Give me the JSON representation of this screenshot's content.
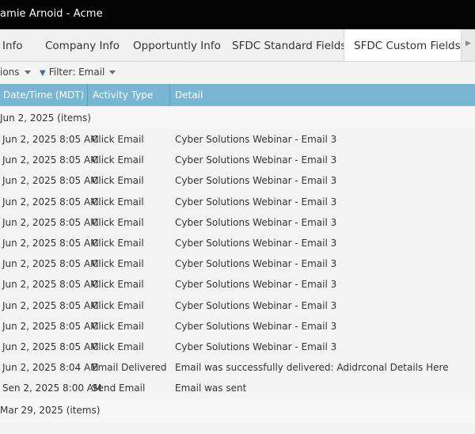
{
  "window": {
    "title": "amie Arnoid - Acme"
  },
  "tabs": [
    {
      "label": "Info"
    },
    {
      "label": "Company Info"
    },
    {
      "label": "Opportuntly Info"
    },
    {
      "label": "SFDC Standard Fields"
    },
    {
      "label": "SFDC Custom Fields"
    }
  ],
  "toolbar": {
    "actions_label": "ions",
    "filter_label": "Filter: Email"
  },
  "table": {
    "columns": [
      "Date/Time (MDT)",
      "Activity Type",
      "Detail"
    ],
    "groups": [
      {
        "label": "Jun 2, 2025 (items)"
      },
      {
        "label": "Mar 29, 2025 (items)"
      }
    ],
    "rows": [
      {
        "date": "Jun 2, 2025 8:05 AM",
        "activity": "Click Email",
        "detail": "Cyber Solutions Webinar - Email 3"
      },
      {
        "date": "Jun 2, 2025 8:05 AM",
        "activity": "Click Email",
        "detail": "Cyber Solutions Webinar - Email 3"
      },
      {
        "date": "Jun 2, 2025 8:05 AM",
        "activity": "Click Email",
        "detail": "Cyber Solutions Webinar - Email 3"
      },
      {
        "date": "Jun 2, 2025 8:05 AM",
        "activity": "Click Email",
        "detail": "Cyber Solutions Webinar - Email 3"
      },
      {
        "date": "Jun 2, 2025 8:05 AM",
        "activity": "Click Email",
        "detail": "Cyber Solutions Webinar - Email 3"
      },
      {
        "date": "Jun 2, 2025 8:05 AM",
        "activity": "Click Email",
        "detail": "Cyber Solutions Webinar - Email 3"
      },
      {
        "date": "Jun 2, 2025 8:05 AM",
        "activity": "Click Email",
        "detail": "Cyber Solutions Webinar - Email 3"
      },
      {
        "date": "Jun 2, 2025 8:05 AM",
        "activity": "Click Email",
        "detail": "Cyber Solutions Webinar - Email 3"
      },
      {
        "date": "Jun 2, 2025 8:05 AM",
        "activity": "Click Email",
        "detail": "Cyber Solutions Webinar - Email 3"
      },
      {
        "date": "Jun 2, 2025 8:05 AM",
        "activity": "Click Email",
        "detail": "Cyber Solutions Webinar - Email 3"
      },
      {
        "date": "Jun 2, 2025 8:05 AM",
        "activity": "Click Email",
        "detail": "Cyber Solutions Webinar - Email 3"
      },
      {
        "date": "Jun 2, 2025 8:04 AM",
        "activity": "Email Delivered",
        "detail": "Email was successfully delivered:  Adidrconal Details Here"
      },
      {
        "date": "Sen 2, 2025 8:00 AM",
        "activity": "Send Email",
        "detail": "Email was sent"
      }
    ]
  },
  "icons": {
    "filter": "funnel-icon",
    "dropdown": "caret-down-icon",
    "scroll": "chevron-right-icon"
  },
  "colors": {
    "titlebar": "#030303",
    "header": "#79b6d4",
    "row_bg": "#f3f3f3"
  }
}
